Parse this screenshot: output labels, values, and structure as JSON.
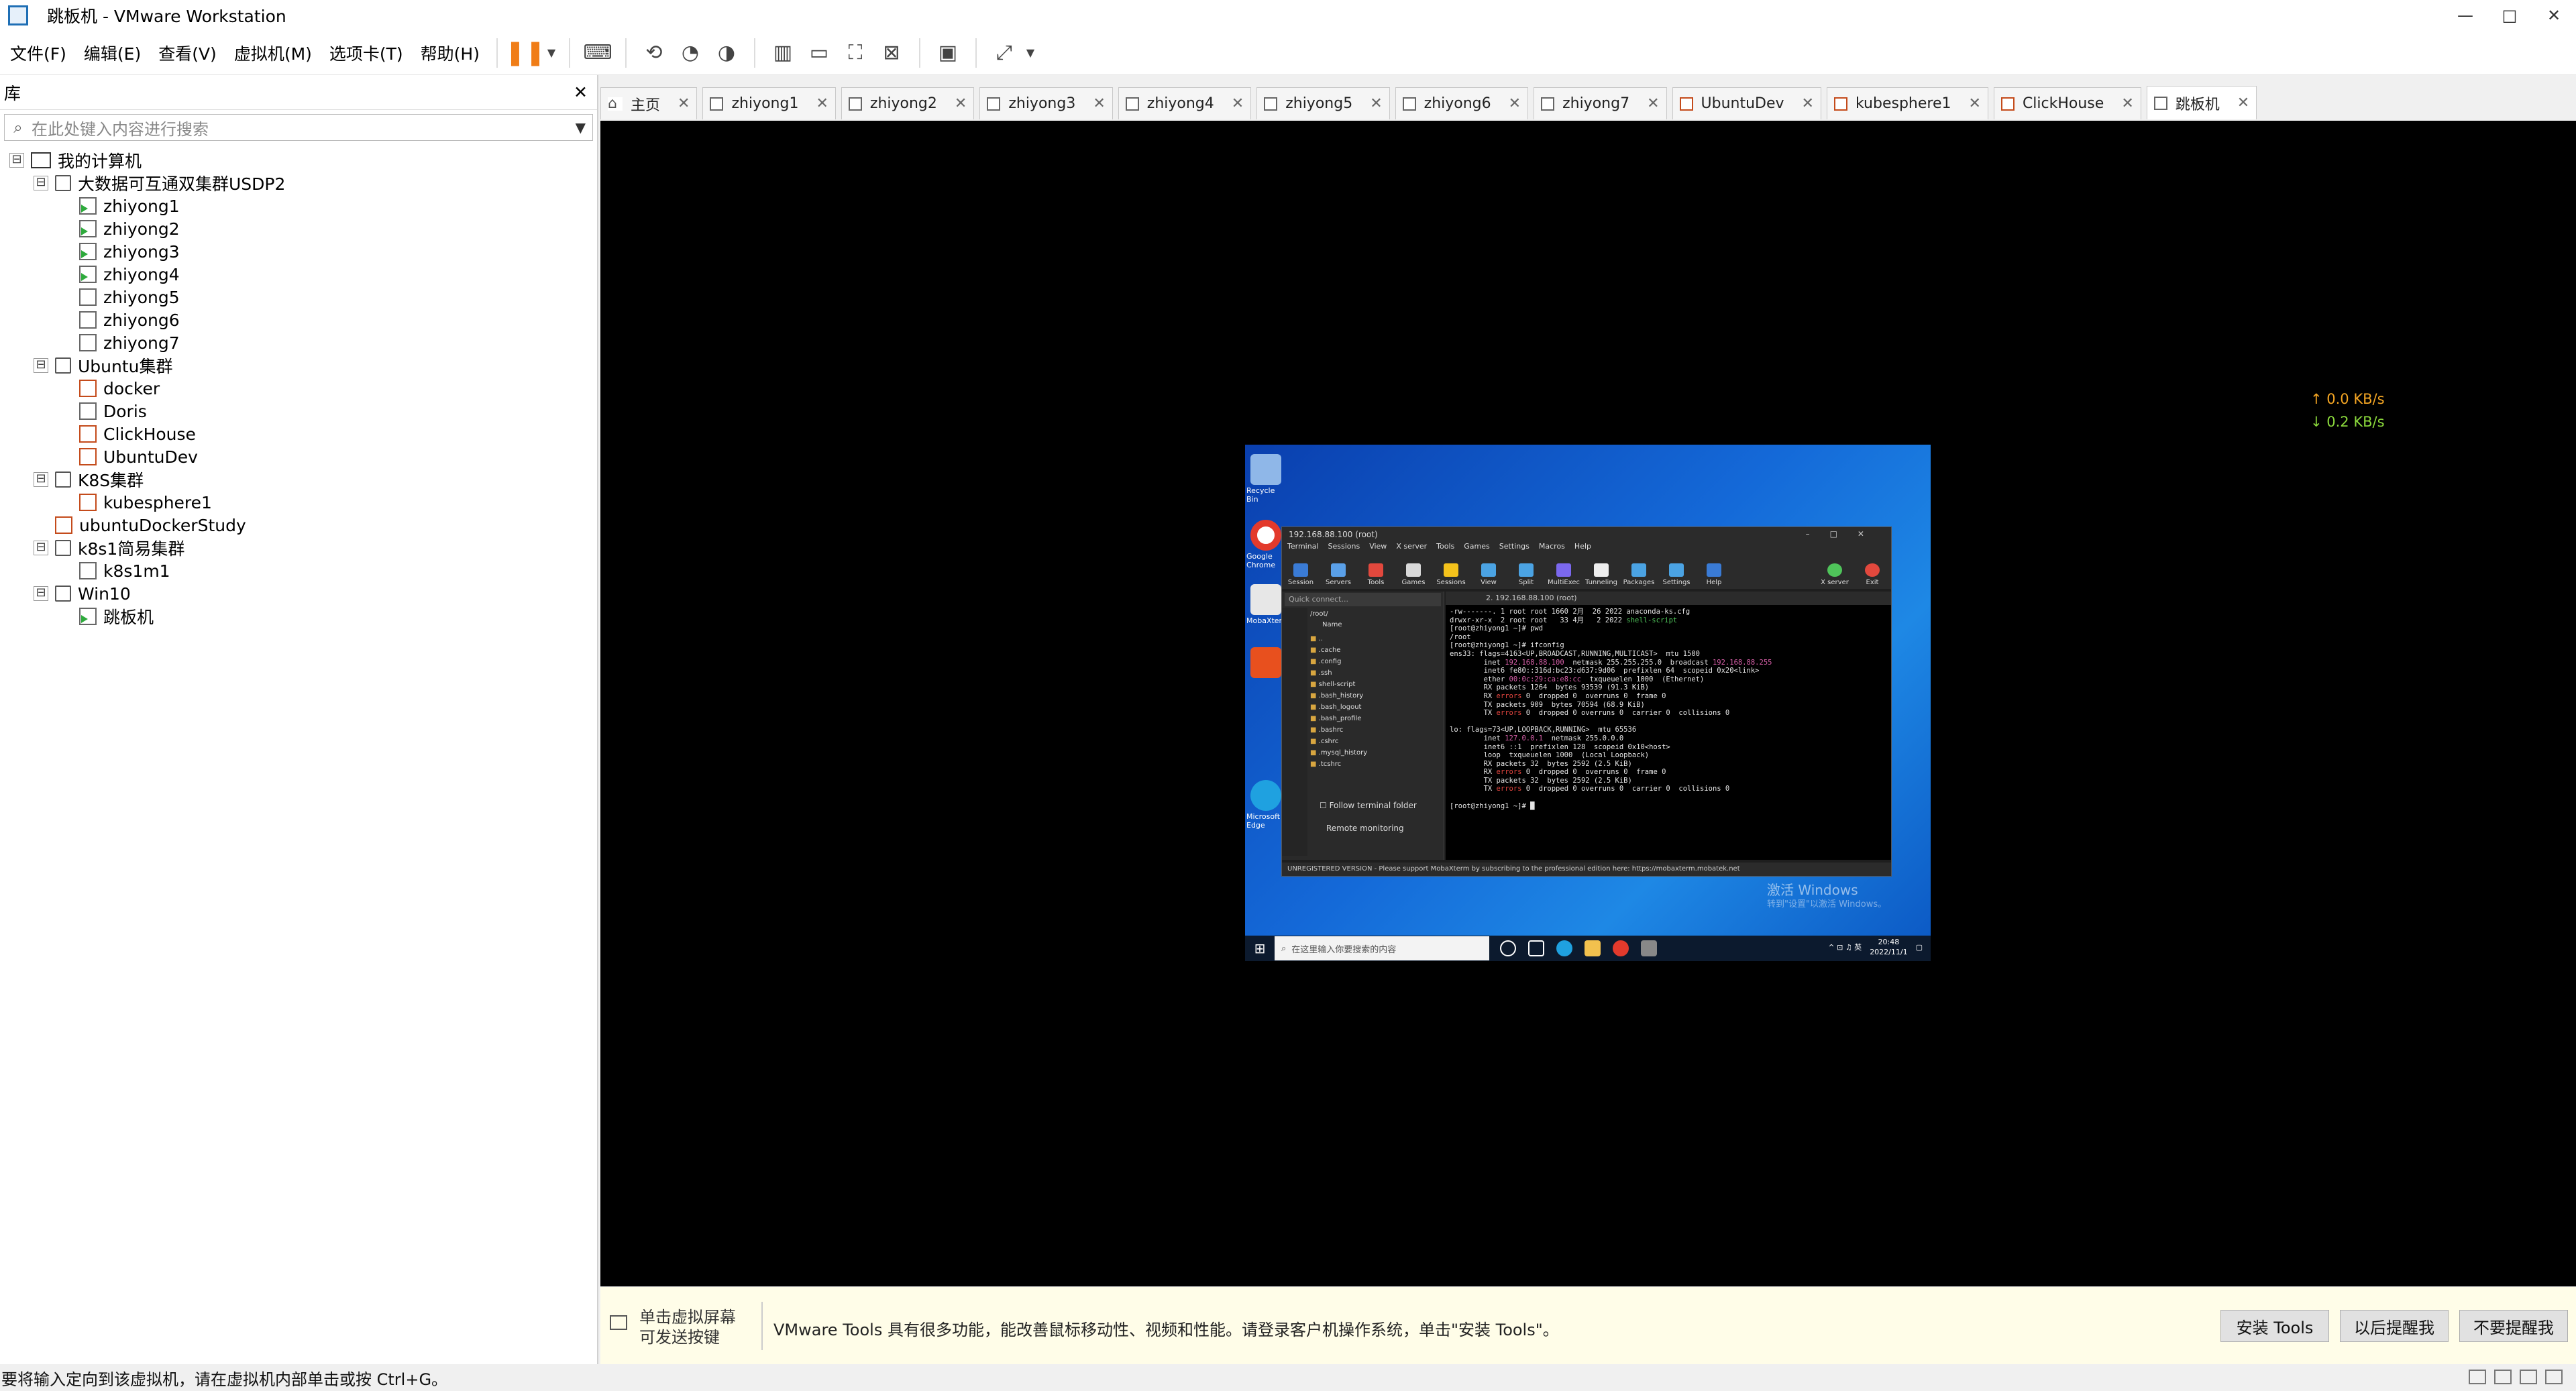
{
  "window": {
    "title": "跳板机 - VMware Workstation",
    "min": "—",
    "max": "□",
    "close": "✕"
  },
  "menu": [
    "文件(F)",
    "编辑(E)",
    "查看(V)",
    "虚拟机(M)",
    "选项卡(T)",
    "帮助(H)"
  ],
  "library": {
    "title": "库",
    "close": "✕",
    "search_placeholder": "在此处键入内容进行搜索",
    "tree": [
      {
        "label": "我的计算机",
        "depth": 0,
        "kind": "pc",
        "toggle": "⊟"
      },
      {
        "label": "大数据可互通双集群USDP2",
        "depth": 1,
        "kind": "folder",
        "toggle": "⊟"
      },
      {
        "label": "zhiyong1",
        "depth": 2,
        "kind": "vm-run"
      },
      {
        "label": "zhiyong2",
        "depth": 2,
        "kind": "vm-run"
      },
      {
        "label": "zhiyong3",
        "depth": 2,
        "kind": "vm-run"
      },
      {
        "label": "zhiyong4",
        "depth": 2,
        "kind": "vm-run"
      },
      {
        "label": "zhiyong5",
        "depth": 2,
        "kind": "vm"
      },
      {
        "label": "zhiyong6",
        "depth": 2,
        "kind": "vm"
      },
      {
        "label": "zhiyong7",
        "depth": 2,
        "kind": "vm"
      },
      {
        "label": "Ubuntu集群",
        "depth": 1,
        "kind": "folder",
        "toggle": "⊟"
      },
      {
        "label": "docker",
        "depth": 2,
        "kind": "vm-linux"
      },
      {
        "label": "Doris",
        "depth": 2,
        "kind": "vm"
      },
      {
        "label": "ClickHouse",
        "depth": 2,
        "kind": "vm-linux"
      },
      {
        "label": "UbuntuDev",
        "depth": 2,
        "kind": "vm-linux"
      },
      {
        "label": "K8S集群",
        "depth": 1,
        "kind": "folder",
        "toggle": "⊟"
      },
      {
        "label": "kubesphere1",
        "depth": 2,
        "kind": "vm-linux"
      },
      {
        "label": "ubuntuDockerStudy",
        "depth": 1,
        "kind": "vm-linux"
      },
      {
        "label": "k8s1简易集群",
        "depth": 1,
        "kind": "folder",
        "toggle": "⊟"
      },
      {
        "label": "k8s1m1",
        "depth": 2,
        "kind": "vm"
      },
      {
        "label": "Win10",
        "depth": 1,
        "kind": "folder",
        "toggle": "⊟"
      },
      {
        "label": "跳板机",
        "depth": 2,
        "kind": "vm-run"
      }
    ]
  },
  "tabs": [
    {
      "label": "主页",
      "icon": "home"
    },
    {
      "label": "zhiyong1",
      "icon": "vm"
    },
    {
      "label": "zhiyong2",
      "icon": "vm"
    },
    {
      "label": "zhiyong3",
      "icon": "vm"
    },
    {
      "label": "zhiyong4",
      "icon": "vm"
    },
    {
      "label": "zhiyong5",
      "icon": "vm"
    },
    {
      "label": "zhiyong6",
      "icon": "vm"
    },
    {
      "label": "zhiyong7",
      "icon": "vm"
    },
    {
      "label": "UbuntuDev",
      "icon": "linux"
    },
    {
      "label": "kubesphere1",
      "icon": "linux"
    },
    {
      "label": "ClickHouse",
      "icon": "linux"
    },
    {
      "label": "跳板机",
      "icon": "vm",
      "active": true
    }
  ],
  "tab_close": "✕",
  "netspeed": {
    "up": "↑ 0.0 KB/s",
    "down": "↓ 0.2 KB/s"
  },
  "guest": {
    "desktop_icons": [
      "Recycle Bin",
      "Google Chrome",
      "MobaXterm",
      "Microsoft Edge"
    ],
    "activate_title": "激活 Windows",
    "activate_sub": "转到\"设置\"以激活 Windows。",
    "taskbar_search": "在这里输入你要搜索的内容",
    "clock_time": "20:48",
    "clock_date": "2022/11/1",
    "moba": {
      "title": "192.168.88.100 (root)",
      "menu": [
        "Terminal",
        "Sessions",
        "View",
        "X server",
        "Tools",
        "Games",
        "Settings",
        "Macros",
        "Help"
      ],
      "tools": [
        "Session",
        "Servers",
        "Tools",
        "Games",
        "Sessions",
        "View",
        "Split",
        "MultiExec",
        "Tunneling",
        "Packages",
        "Settings",
        "Help"
      ],
      "tools_right": [
        "X server",
        "Exit"
      ],
      "quick_connect": "Quick connect...",
      "path": "/root/",
      "files_header": "Name",
      "files": [
        "..",
        ".cache",
        ".config",
        ".ssh",
        "shell-script",
        ".bash_history",
        ".bash_logout",
        ".bash_profile",
        ".bashrc",
        ".cshrc",
        ".mysql_history",
        ".tcshrc"
      ],
      "follow": "Follow terminal folder",
      "remote": "Remote monitoring",
      "term_tab": "2. 192.168.88.100 (root)",
      "status": "UNREGISTERED VERSION  -  Please support MobaXterm by subscribing to the professional edition here:  https://mobaxterm.mobatek.net",
      "lines": [
        "-rw-------. 1 root root 1660 2月  26 2022 anaconda-ks.cfg",
        "drwxr-xr-x  2 root root   33 4月   2 2022 shell-script",
        "[root@zhiyong1 ~]# pwd",
        "/root",
        "[root@zhiyong1 ~]# ifconfig",
        "ens33: flags=4163<UP,BROADCAST,RUNNING,MULTICAST>  mtu 1500",
        "        inet 192.168.88.100  netmask 255.255.255.0  broadcast 192.168.88.255",
        "        inet6 fe80::316d:bc23:d637:9d06  prefixlen 64  scopeid 0x20<link>",
        "        ether 00:0c:29:ca:e8:cc  txqueuelen 1000  (Ethernet)",
        "        RX packets 1264  bytes 93539 (91.3 KiB)",
        "        RX errors 0  dropped 0  overruns 0  frame 0",
        "        TX packets 909  bytes 70594 (68.9 KiB)",
        "        TX errors 0  dropped 0 overruns 0  carrier 0  collisions 0",
        "",
        "lo: flags=73<UP,LOOPBACK,RUNNING>  mtu 65536",
        "        inet 127.0.0.1  netmask 255.0.0.0",
        "        inet6 ::1  prefixlen 128  scopeid 0x10<host>",
        "        loop  txqueuelen 1000  (Local Loopback)",
        "        RX packets 32  bytes 2592 (2.5 KiB)",
        "        RX errors 0  dropped 0  overruns 0  frame 0",
        "        TX packets 32  bytes 2592 (2.5 KiB)",
        "        TX errors 0  dropped 0 overruns 0  carrier 0  collisions 0",
        "",
        "[root@zhiyong1 ~]# █"
      ]
    }
  },
  "tools_bar": {
    "hint_line1": "单击虚拟屏幕",
    "hint_line2": "可发送按键",
    "message": "VMware Tools 具有很多功能，能改善鼠标移动性、视频和性能。请登录客户机操作系统，单击\"安装 Tools\"。",
    "install": "安装 Tools",
    "later": "以后提醒我",
    "never": "不要提醒我"
  },
  "status": "要将输入定向到该虚拟机，请在虚拟机内部单击或按 Ctrl+G。"
}
